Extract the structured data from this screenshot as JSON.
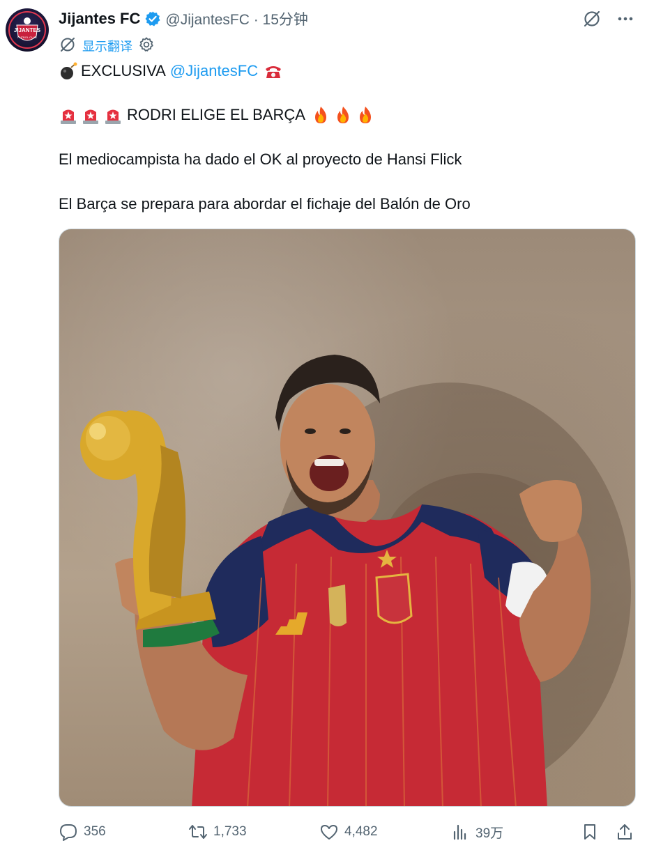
{
  "author": {
    "name": "Jijantes FC",
    "handle_time": "@JijantesFC · 15分钟",
    "avatar_text": "JIJANTES",
    "avatar_subtext": "FUTBOL CLUB"
  },
  "translate": {
    "label": "显示翻译"
  },
  "tweet": {
    "line1_prefix": "EXCLUSIVA",
    "line1_mention": "@JijantesFC",
    "line2": "RODRI ELIGE EL BARÇA",
    "line3": "El mediocampista ha dado el OK al proyecto de Hansi Flick",
    "line4": "El Barça se prepara para abordar el fichaje del Balón de Oro"
  },
  "metrics": {
    "replies": "356",
    "retweets": "1,733",
    "likes": "4,482",
    "views": "39万"
  },
  "icons": {
    "header": [
      "grok-icon",
      "more-icon"
    ],
    "translate": [
      "translate-icon",
      "settings-icon"
    ],
    "emoji": [
      "bomb-emoji",
      "telephone-emoji",
      "siren-emoji",
      "fire-emoji"
    ],
    "actions": [
      "reply-icon",
      "retweet-icon",
      "like-icon",
      "views-icon",
      "bookmark-icon",
      "share-icon"
    ]
  },
  "colors": {
    "accent": "#1d9bf0",
    "muted": "#536471",
    "text": "#0f1419"
  }
}
